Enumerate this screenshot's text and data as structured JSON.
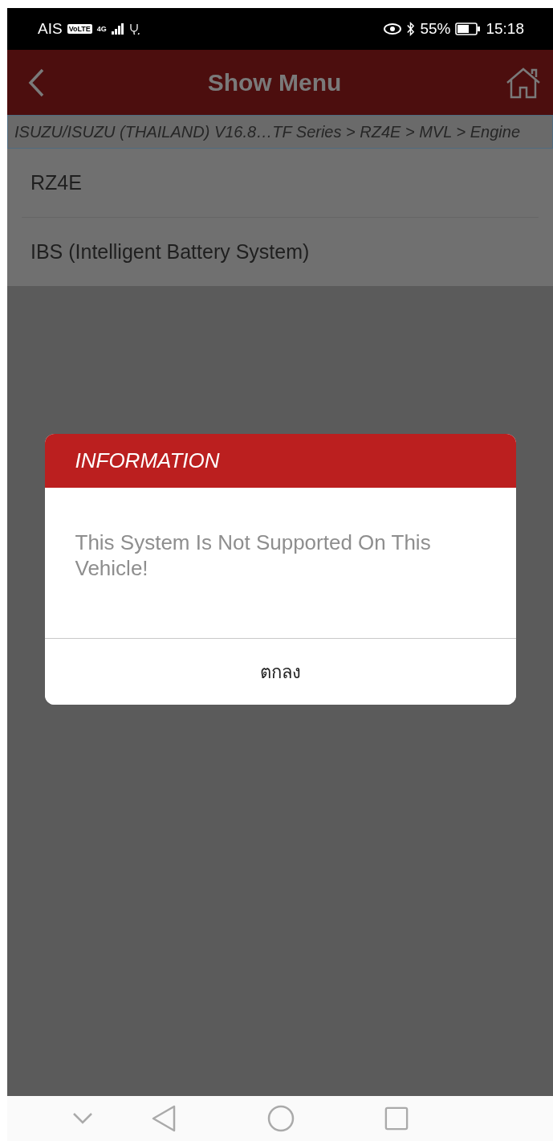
{
  "status_bar": {
    "carrier": "AIS",
    "volte": "VoLTE",
    "network": "4G",
    "battery": "55%",
    "time": "15:18"
  },
  "header": {
    "title": "Show Menu"
  },
  "breadcrumb": "ISUZU/ISUZU (THAILAND) V16.8…TF Series > RZ4E > MVL > Engine",
  "menu_items": [
    {
      "label": "RZ4E"
    },
    {
      "label": "IBS (Intelligent Battery System)"
    }
  ],
  "dialog": {
    "title": "INFORMATION",
    "message": "This System Is Not Supported On This Vehicle!",
    "button": "ตกลง"
  }
}
